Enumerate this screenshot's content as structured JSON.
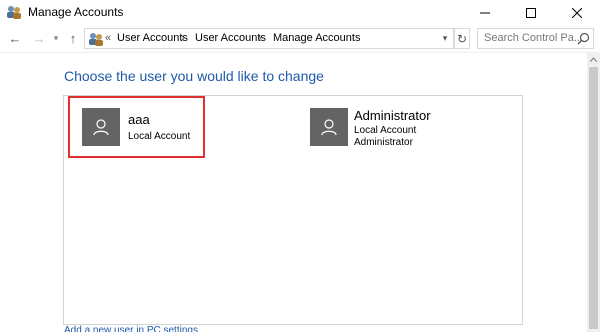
{
  "window": {
    "title": "Manage Accounts",
    "icon": "users-control-panel-icon"
  },
  "titlebar_buttons": {
    "minimize_icon": "minimize-icon",
    "maximize_icon": "maximize-icon",
    "close_icon": "close-icon"
  },
  "navigation": {
    "back_glyph": "←",
    "forward_glyph": "→",
    "dropdown_glyph": "▾",
    "up_glyph": "↑"
  },
  "address_bar": {
    "chevrons": "«",
    "breadcrumbs": [
      "User Accounts",
      "User Accounts",
      "Manage Accounts"
    ],
    "separator": "›",
    "dropdown_glyph": "▾",
    "refresh_glyph": "↻"
  },
  "search": {
    "placeholder": "Search Control Pa..."
  },
  "main": {
    "heading": "Choose the user you would like to change",
    "accounts": [
      {
        "name": "aaa",
        "details": [
          "Local Account"
        ],
        "selected": true
      },
      {
        "name": "Administrator",
        "details": [
          "Local Account",
          "Administrator"
        ],
        "selected": false
      }
    ],
    "add_user_link": "Add a new user in PC settings"
  },
  "colors": {
    "heading": "#1e5aa8",
    "selection_border": "#e23030",
    "avatar_bg": "#646464"
  }
}
